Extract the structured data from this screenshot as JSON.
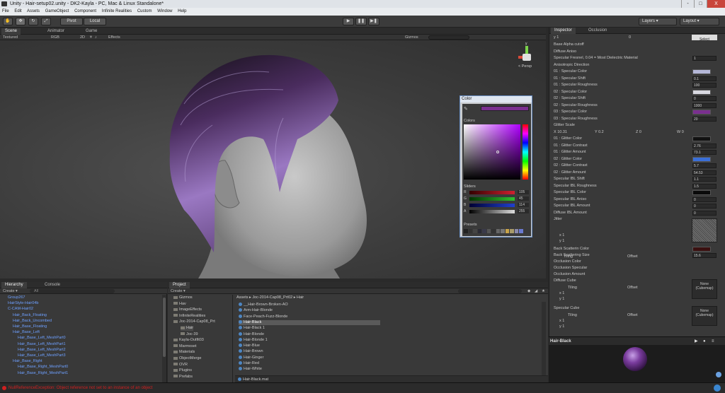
{
  "window": {
    "title": "Unity - Hair-setup02.unity - DK2-Kayla - PC, Mac & Linux Standalone*",
    "controls": [
      "-",
      "□",
      "X"
    ]
  },
  "menu": [
    "File",
    "Edit",
    "Assets",
    "GameObject",
    "Component",
    "Infinite Realities",
    "Custom",
    "Window",
    "Help"
  ],
  "toolbar": {
    "pivot": "Pivot",
    "local": "Local",
    "layers": "Layers",
    "layout": "Layout"
  },
  "scene_tabs": {
    "scene": "Scene",
    "animator": "Animator",
    "game": "Game"
  },
  "scene_bar": {
    "shading": "Textured",
    "render": "RGB",
    "mode2d": "2D",
    "effects": "Effects",
    "gizmos": "Gizmos"
  },
  "gizmo": {
    "y": "y",
    "x": "x",
    "persp": "< Persp"
  },
  "color_picker": {
    "title": "Color",
    "colors_label": "Colors",
    "sliders_label": "Sliders",
    "presets_label": "Presets",
    "current_color": "#7a2f8f",
    "channels": [
      {
        "name": "R",
        "value": "105",
        "color": "#c02030"
      },
      {
        "name": "G",
        "value": "45",
        "color": "#30a030"
      },
      {
        "name": "B",
        "value": "114",
        "color": "#2040c0"
      },
      {
        "name": "A",
        "value": "255",
        "color": "#bbbbbb"
      }
    ]
  },
  "inspector": {
    "tab_inspector": "Inspector",
    "tab_occlusion": "Occlusion",
    "tiling_y": "y 1",
    "tiling_y_val": "0",
    "select": "Select",
    "rows": [
      {
        "label": "Base Alpha cutoff"
      },
      {
        "label": "Diffuse Aniso"
      },
      {
        "label": "Specular Fresnel, 0.04 = Most Dielectric Material",
        "value": "1"
      },
      {
        "label": "Anisotropic Direction"
      },
      {
        "label": "01 : Specular Color",
        "swatch": "#b5b8d8"
      },
      {
        "label": "01 : Specular Shift",
        "value": "0.1"
      },
      {
        "label": "01 : Specular Roughness",
        "value": "100"
      },
      {
        "label": "02 : Specular Color",
        "swatch": "#d8d8e0"
      },
      {
        "label": "02 : Specular Shift",
        "value": "0"
      },
      {
        "label": "02 : Specular Roughness",
        "value": "1000"
      },
      {
        "label": "03 : Specular Color",
        "swatch": "#7a2f8f"
      },
      {
        "label": "03 : Specular Roughness",
        "value": "20"
      },
      {
        "label": "Glitter Scale"
      },
      {
        "label": "",
        "vector": [
          "X 10.31",
          "Y 0.2",
          "Z 0",
          "W 0"
        ]
      },
      {
        "label": "01 : Glitter Color",
        "swatch": "#111111"
      },
      {
        "label": "01 : Glitter Contrast",
        "value": "2.76"
      },
      {
        "label": "01 : Glitter Amount",
        "value": "73.1"
      },
      {
        "label": "02 : Glitter Color",
        "swatch": "#3a6fd8"
      },
      {
        "label": "02 : Glitter Contrast",
        "value": "5.7"
      },
      {
        "label": "02 : Glitter Amount",
        "value": "54.53"
      },
      {
        "label": "Specular IBL Shift",
        "value": "1.1"
      },
      {
        "label": "Specular IBL Roughness",
        "value": "1.5"
      },
      {
        "label": "Specular IBL Color",
        "swatch": "#0a0a0a"
      },
      {
        "label": "Specular IBL Aniso",
        "value": "0"
      },
      {
        "label": "Specular IBL Amount",
        "value": "0"
      },
      {
        "label": "Diffuse IBL Amount",
        "value": "0"
      },
      {
        "label": "Jitter"
      }
    ],
    "tiling_label": "Tiling",
    "offset_label": "Offset",
    "x_row": "x 1",
    "y_row": "y 1",
    "zero": "0",
    "back_scatter_color": "Back Scatterin Color",
    "back_scatter_size": "Back Scattering Size",
    "back_scatter_size_val": "15.6",
    "occlusion_color": "Occlusion Color",
    "occlusion_specular": "Occlusion Specular",
    "occlusion_amount": "Occlusion Amount",
    "diffuse_cube": "Diffuse Cube",
    "specular_cube": "Specular Cube",
    "none_cubemap": "None (Cubemap)",
    "preview_title": "Hair-Black"
  },
  "hierarchy": {
    "tab": "Hierarchy",
    "tab2": "Console",
    "create": "Create ▾",
    "search": "All",
    "items": [
      {
        "label": "Group267",
        "indent": 1
      },
      {
        "label": "HairStyle-Hair04b",
        "indent": 1
      },
      {
        "label": "C-CAM-Hair02",
        "indent": 1
      },
      {
        "label": "Hair_Back_Floating",
        "indent": 2
      },
      {
        "label": "Hair_Back_Uncombed",
        "indent": 2
      },
      {
        "label": "Hair_Base_Floating",
        "indent": 2
      },
      {
        "label": "Hair_Base_Left",
        "indent": 2
      },
      {
        "label": "Hair_Base_Left_MeshPart0",
        "indent": 3
      },
      {
        "label": "Hair_Base_Left_MeshPart1",
        "indent": 3
      },
      {
        "label": "Hair_Base_Left_MeshPart2",
        "indent": 3
      },
      {
        "label": "Hair_Base_Left_MeshPart3",
        "indent": 3
      },
      {
        "label": "Hair_Base_Right",
        "indent": 2
      },
      {
        "label": "Hair_Base_Right_MeshPart0",
        "indent": 3
      },
      {
        "label": "Hair_Base_Right_MeshPart1",
        "indent": 3
      }
    ]
  },
  "project": {
    "tab": "Project",
    "create": "Create ▾",
    "breadcrumb": "Assets ▸ Joc-2014-Cap08_Prt02 ▸ Hair",
    "folders": [
      "Gizmos",
      "Hav",
      "ImageEffects",
      "InfiniteRealities",
      "Joc-2014-Cap08_Prt",
      "Hair",
      "Joc-39",
      "Kayla-Outfit03",
      "Marmoset",
      "Materials",
      "ObjectMerge",
      "OVR",
      "Plugins",
      "Prefabs"
    ],
    "assets": [
      "__Hair-Brown-Broken-AO",
      "Arm-Hair-Blonde",
      "Face-Peach-Fuzz-Blonde",
      "Hair-Black",
      "Hair-Black 1",
      "Hair-Blonde",
      "Hair-Blonde 1",
      "Hair-Blue",
      "Hair-Brown",
      "Hair-Ginger",
      "Hair-Red",
      "Hair-White"
    ],
    "selected_file": "Hair-Black.mat"
  },
  "status": {
    "message": "NullReferenceException: Object reference not set to an instance of an object"
  }
}
